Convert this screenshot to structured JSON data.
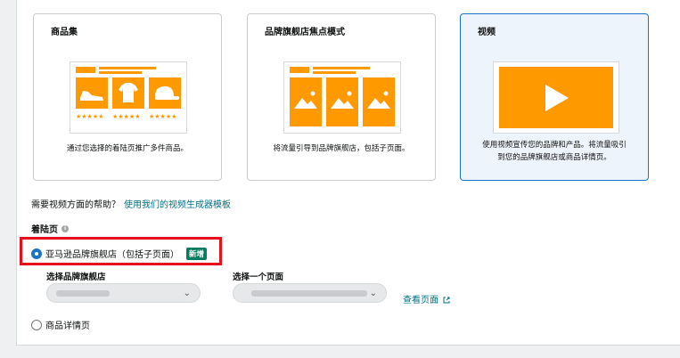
{
  "cards": [
    {
      "title": "商品集",
      "description": "通过您选择的着陆页推广多件商品。",
      "selected": false
    },
    {
      "title": "品牌旗舰店焦点模式",
      "description": "将流量引导到品牌旗舰店，包括子页面。",
      "selected": false
    },
    {
      "title": "视频",
      "description_line1": "使用视频宣传您的品牌和产品。将流量吸引",
      "description_line2": "到您的品牌旗舰店或商品详情页。",
      "selected": true
    }
  ],
  "help": {
    "question": "需要视频方面的帮助？",
    "link": "使用我们的视频生成器模板"
  },
  "landing_page": {
    "label": "着陆页",
    "options": [
      {
        "label": "亚马逊品牌旗舰店（包括子页面）",
        "badge": "新增",
        "checked": true
      },
      {
        "label": "商品详情页",
        "checked": false
      }
    ],
    "store_select_label": "选择品牌旗舰店",
    "page_select_label": "选择一个页面",
    "view_page_link": "查看页面"
  },
  "colors": {
    "accent": "#1a73c6",
    "orange": "#ff9900",
    "link": "#007185",
    "badge": "#067d62",
    "highlight": "#e8101c"
  },
  "icons": [
    "shoe-icon",
    "shirt-icon",
    "cap-icon",
    "image-icon",
    "play-icon",
    "info-icon",
    "chevron-down-icon",
    "external-link-icon"
  ]
}
